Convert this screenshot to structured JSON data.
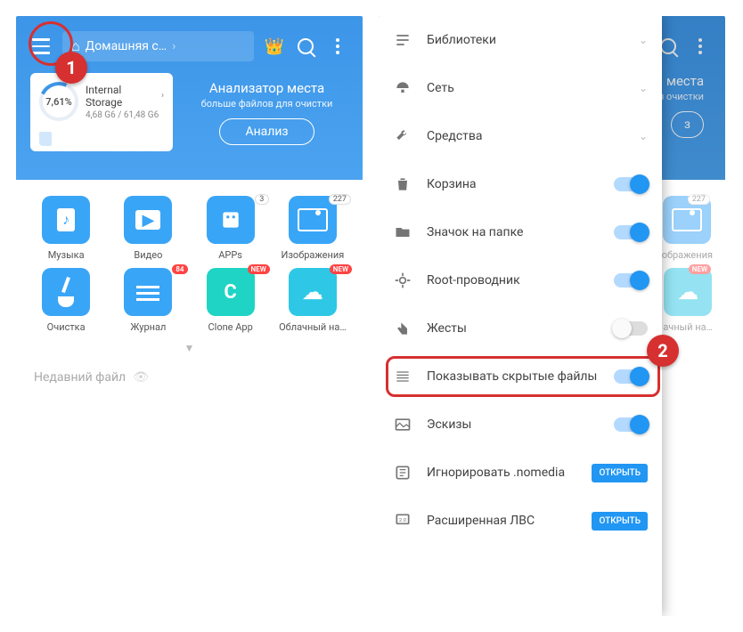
{
  "left": {
    "breadcrumb": "Домашняя с…",
    "analyzer": {
      "title": "Анализатор места",
      "subtitle": "больше файлов для очистки",
      "button": "Анализ",
      "storage_name": "Internal Storage",
      "storage_pct": "7,61%",
      "storage_size": "4,68 G6 / 61,48 G6"
    },
    "grid": {
      "music": "Музыка",
      "video": "Видео",
      "apps": "APPs",
      "apps_badge": "3",
      "images": "Изображения",
      "images_badge": "227",
      "clean": "Очистка",
      "log": "Журнал",
      "log_badge": "84",
      "clone": "Clone App",
      "clone_badge": "NEW",
      "cloud": "Облачный на…",
      "cloud_badge": "NEW"
    },
    "recent": "Недавний файл"
  },
  "right": {
    "analyzer_title_partial": "места",
    "analyzer_sub_partial": "я очистки",
    "grid_images": "ображения",
    "grid_images_badge": "227",
    "grid_cloud": "ачный на…",
    "grid_cloud_badge": "NEW"
  },
  "drawer": {
    "libraries": "Библиотеки",
    "network": "Сеть",
    "tools": "Средства",
    "trash": "Корзина",
    "folder_icon": "Значок на папке",
    "root": "Root-проводник",
    "gestures": "Жесты",
    "hidden": "Показывать скрытые файлы",
    "thumbs": "Эскизы",
    "nomedia": "Игнорировать .nomedia",
    "lan": "Расширенная ЛВС",
    "open": "ОТКРЫТЬ"
  },
  "callouts": {
    "one": "1",
    "two": "2"
  }
}
